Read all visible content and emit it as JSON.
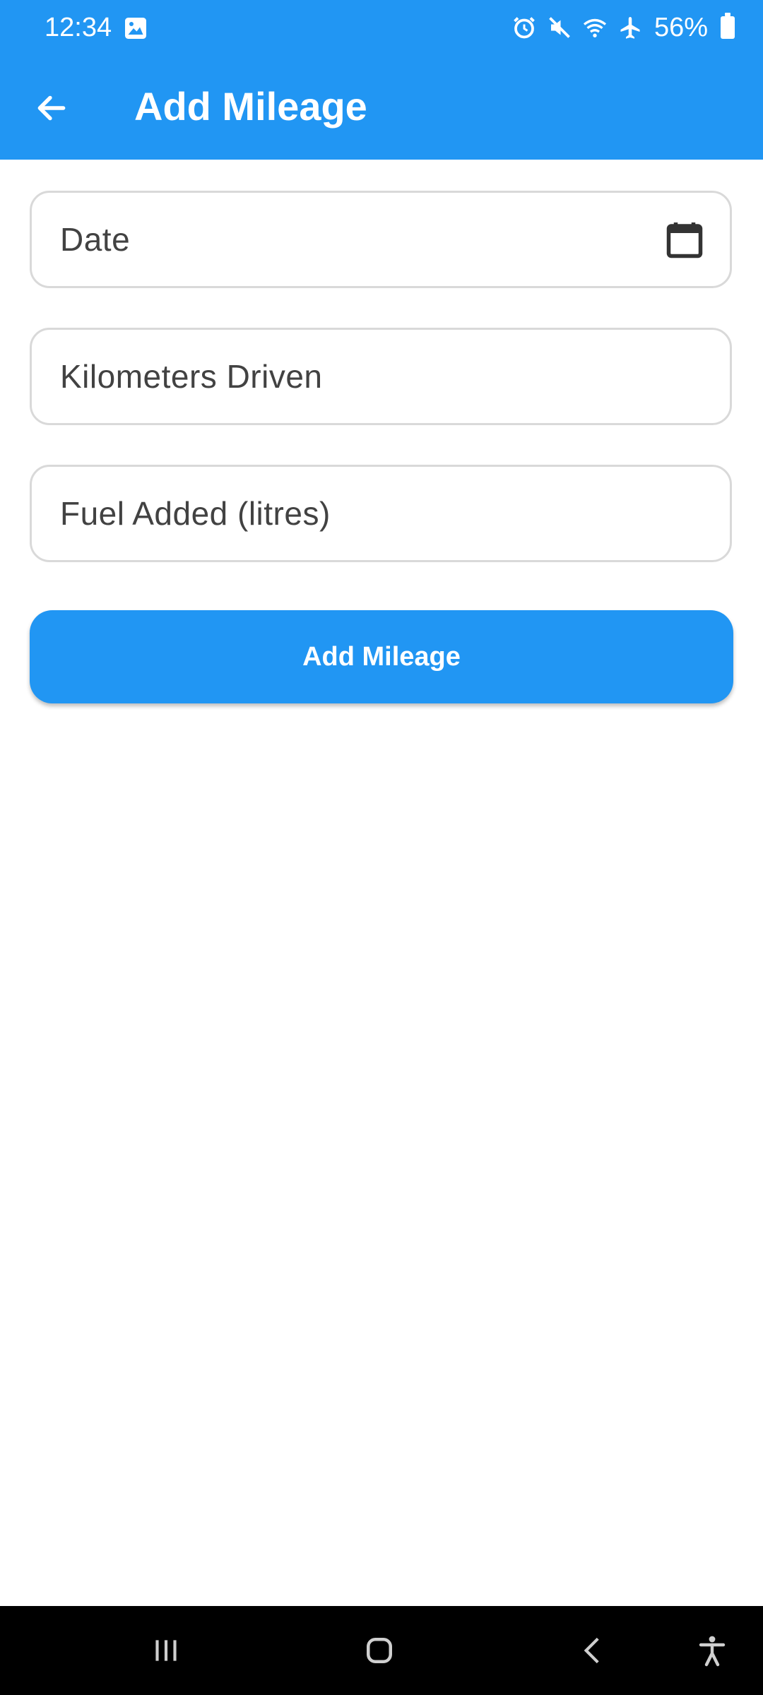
{
  "status_bar": {
    "time": "12:34",
    "battery_percent": "56%",
    "icons": [
      "image-icon",
      "alarm-icon",
      "mute-icon",
      "wifi-icon",
      "airplane-icon",
      "battery-icon"
    ]
  },
  "app_bar": {
    "title": "Add Mileage",
    "back_icon": "arrow-left-icon"
  },
  "form": {
    "date": {
      "label": "Date",
      "icon": "calendar-icon",
      "value": ""
    },
    "kilometers": {
      "label": "Kilometers Driven",
      "value": ""
    },
    "fuel": {
      "label": "Fuel Added (litres)",
      "value": ""
    }
  },
  "submit_button": {
    "label": "Add Mileage"
  },
  "nav_bar": {
    "icons": [
      "recents-icon",
      "home-icon",
      "back-icon",
      "accessibility-icon"
    ]
  },
  "colors": {
    "primary": "#2196F3",
    "text": "#424242",
    "border": "#d9d9d9",
    "nav_bg": "#000000"
  }
}
